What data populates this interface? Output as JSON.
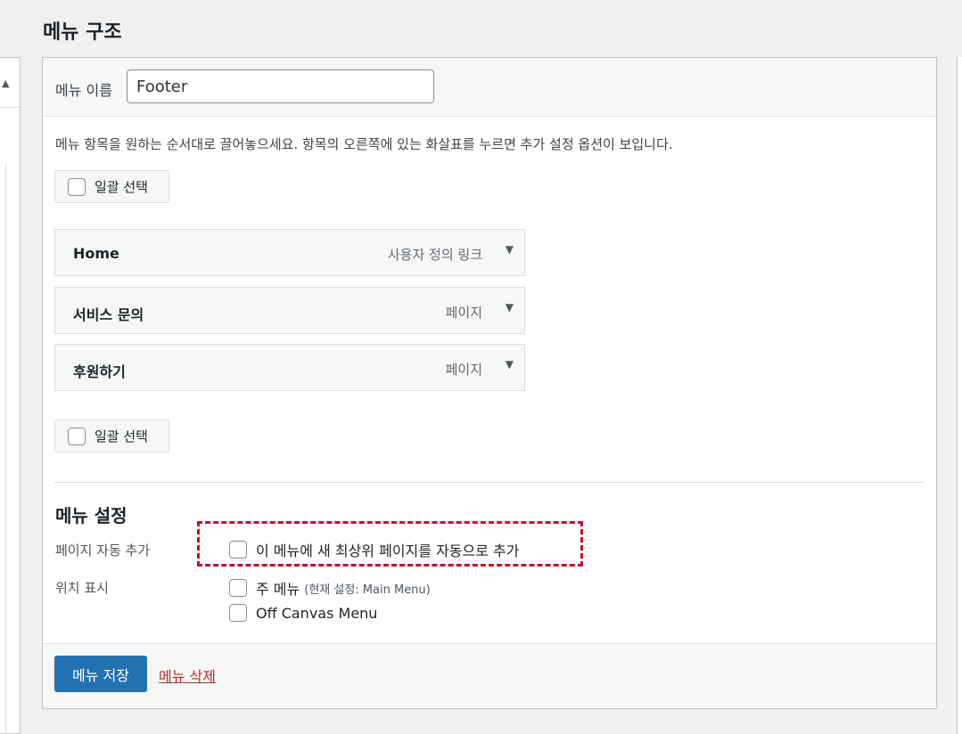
{
  "header": {
    "title": "메뉴 구조"
  },
  "menu_name": {
    "label": "메뉴 이름",
    "value": "Footer"
  },
  "instructions": "메뉴 항목을 원하는 순서대로 끌어놓으세요. 항목의 오른쪽에 있는 화살표를 누르면 추가 설정 옵션이 보입니다.",
  "bulk_select": {
    "label": "일괄 선택"
  },
  "menu_items": [
    {
      "title": "Home",
      "type": "사용자 정의 링크"
    },
    {
      "title": "서비스 문의",
      "type": "페이지"
    },
    {
      "title": "후원하기",
      "type": "페이지"
    }
  ],
  "settings": {
    "title": "메뉴 설정",
    "auto_add_label": "페이지 자동 추가",
    "auto_add_option": "이 메뉴에 새 최상위 페이지를 자동으로 추가",
    "location_label": "위치 표시",
    "locations": [
      {
        "label": "주 메뉴",
        "note": "(현재 설정: Main Menu)"
      },
      {
        "label": "Off Canvas Menu"
      }
    ]
  },
  "footer": {
    "save_label": "메뉴 저장",
    "delete_label": "메뉴 삭제"
  },
  "colors": {
    "primary": "#2271b1",
    "delete": "#b32d2e",
    "highlight": "#c8102e"
  }
}
